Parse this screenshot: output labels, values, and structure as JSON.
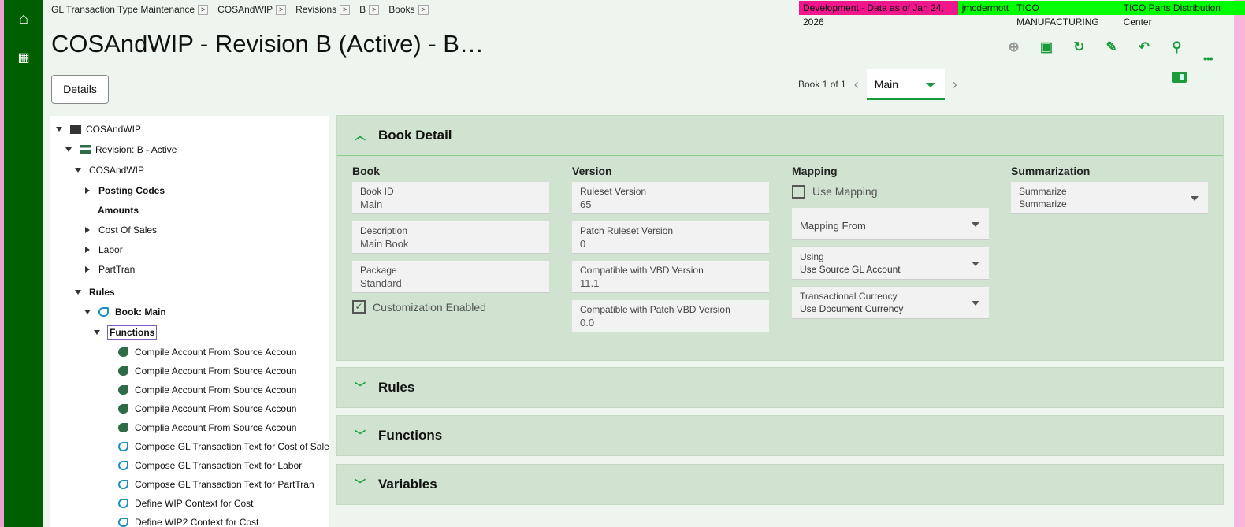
{
  "breadcrumb": [
    "GL Transaction Type Maintenance",
    "COSAndWIP",
    "Revisions",
    "B",
    "Books"
  ],
  "env": {
    "banner": "Development - Data as of Jan 24, 2026",
    "user": "jmcdermott",
    "company": "TICO MANUFACTURING",
    "site": "TICO Parts Distribution Center",
    "colors": {
      "dev": "#f0168c",
      "info": "#00ff00"
    }
  },
  "title": "COSAndWIP - Revision B (Active) - B…",
  "details_label": "Details",
  "toolbar": {
    "icons": [
      "add-icon",
      "save-icon",
      "refresh-icon",
      "clear-icon",
      "undo-icon",
      "search-icon"
    ],
    "more": "•••"
  },
  "pager": {
    "text": "Book 1 of 1",
    "selected": "Main"
  },
  "tree": {
    "root": "COSAndWIP",
    "revision": "Revision: B - Active",
    "sub": "COSAndWIP",
    "items": [
      "Posting Codes",
      "Amounts",
      "Cost Of Sales",
      "Labor",
      "PartTran"
    ],
    "rules": "Rules",
    "book": "Book: Main",
    "functions": "Functions",
    "function_items": [
      "Compile Account From Source Account And Cor",
      "Compile Account From Source Account And Div",
      "Compile Account From Source Account And Prir",
      "Compile Account From Source Account And Prir",
      "Complie Account From Source Account And Giv",
      "Compose GL Transaction Text for Cost of Sales",
      "Compose GL Transaction Text for Labor",
      "Compose GL Transaction Text for PartTran",
      "Define WIP Context for Cost",
      "Define WIP2 Context for Cost"
    ]
  },
  "book_detail": {
    "title": "Book Detail",
    "book": {
      "title": "Book",
      "fields": [
        {
          "label": "Book ID",
          "value": "Main"
        },
        {
          "label": "Description",
          "value": "Main Book"
        },
        {
          "label": "Package",
          "value": "Standard"
        }
      ],
      "customization": "Customization Enabled",
      "customization_checked": true
    },
    "version": {
      "title": "Version",
      "fields": [
        {
          "label": "Ruleset Version",
          "value": "65"
        },
        {
          "label": "Patch Ruleset Version",
          "value": "0"
        },
        {
          "label": "Compatible with VBD Version",
          "value": "11.1"
        },
        {
          "label": "Compatible with Patch VBD Version",
          "value": "0.0"
        }
      ]
    },
    "mapping": {
      "title": "Mapping",
      "use_mapping": "Use Mapping",
      "use_mapping_checked": false,
      "mapping_from": "Mapping From",
      "using_label": "Using",
      "using_value": "Use Source GL Account",
      "currency_label": "Transactional Currency",
      "currency_value": "Use Document Currency"
    },
    "summarization": {
      "title": "Summarization",
      "label": "Summarize",
      "value": "Summarize"
    }
  },
  "sections": [
    "Rules",
    "Functions",
    "Variables"
  ]
}
